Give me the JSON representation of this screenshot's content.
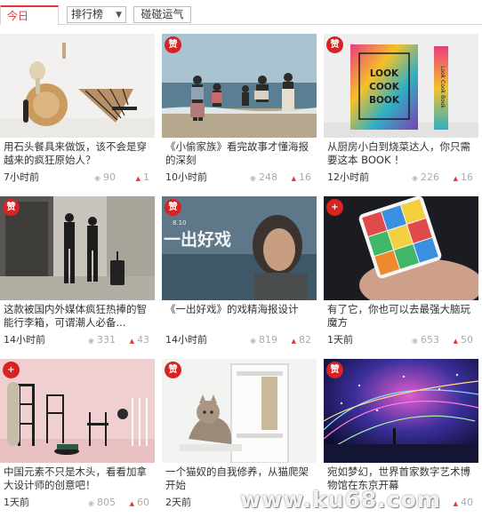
{
  "filter": {
    "today_tab": "今日",
    "ranking_select": "排行榜",
    "luck_button": "碰碰运气"
  },
  "cards": [
    {
      "badge": "",
      "title": "用石头餐具来做饭，该不会是穿越来的疯狂原始人？",
      "time": "7小时前",
      "views": "90",
      "likes": "1"
    },
    {
      "badge": "赞",
      "title": "《小偷家族》看完故事才懂海报的深刻",
      "time": "10小时前",
      "views": "248",
      "likes": "16"
    },
    {
      "badge": "赞",
      "title": "从厨房小白到烧菜达人，你只需要这本 BOOK ！",
      "time": "12小时前",
      "views": "226",
      "likes": "16"
    },
    {
      "badge": "赞",
      "title": "这款被国内外媒体疯狂热捧的智能行李箱，可谓潮人必备...",
      "time": "14小时前",
      "views": "331",
      "likes": "43"
    },
    {
      "badge": "赞",
      "title": "《一出好戏》的戏精海报设计",
      "time": "14小时前",
      "views": "819",
      "likes": "82"
    },
    {
      "badge": "+",
      "title": "有了它，你也可以去最强大脑玩魔方",
      "time": "1天前",
      "views": "653",
      "likes": "50"
    },
    {
      "badge": "+",
      "title": "中国元素不只是木头，看看加拿大设计师的创意吧！",
      "time": "1天前",
      "views": "805",
      "likes": "60"
    },
    {
      "badge": "赞",
      "title": "一个猫奴的自我修养，从猫爬架开始",
      "time": "2天前",
      "views": "",
      "likes": ""
    },
    {
      "badge": "赞",
      "title": "宛如梦幻，世界首家数字艺术博物馆在东京开幕",
      "time": "",
      "views": "",
      "likes": "40"
    }
  ],
  "thumbnails": {
    "book_cover": "LOOK COOK BOOK",
    "book_spine": "Look Cook Book",
    "movie_title": "一出好戏",
    "movie_date": "8.10"
  },
  "watermark": "www.ku68.com",
  "colors": {
    "accent": "#e23434",
    "badge": "#d92222"
  }
}
